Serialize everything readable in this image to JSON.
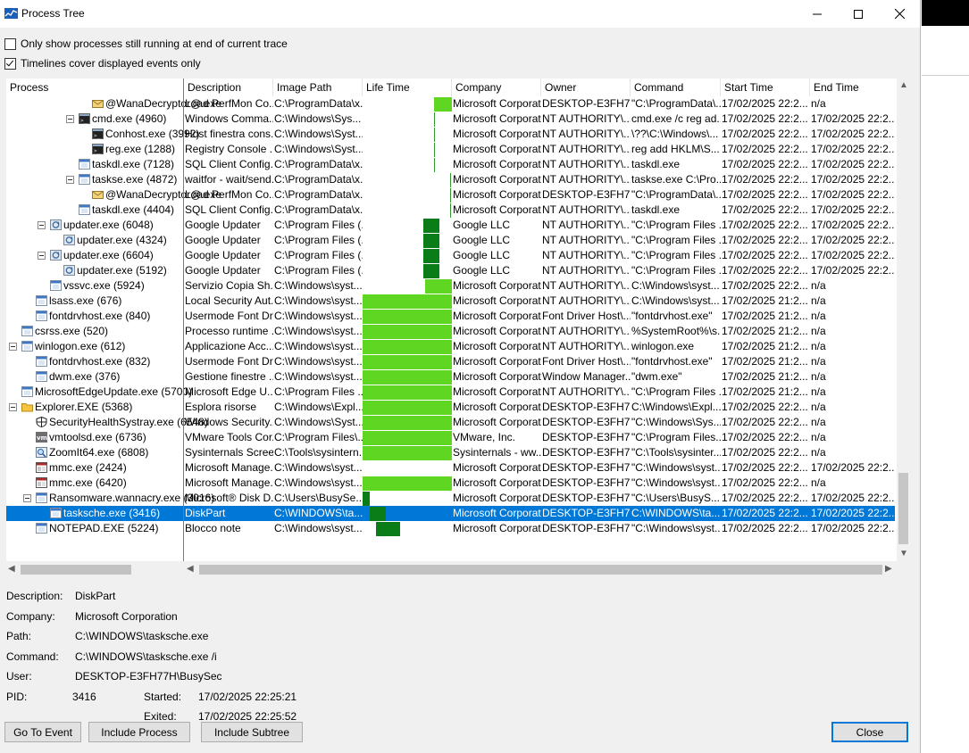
{
  "window": {
    "title": "Process Tree"
  },
  "options": [
    {
      "label": "Only show processes still running at end of current trace",
      "checked": false
    },
    {
      "label": "Timelines cover displayed events only",
      "checked": true
    }
  ],
  "columns": [
    "Process",
    "Description",
    "Image Path",
    "Life Time",
    "Company",
    "Owner",
    "Command",
    "Start Time",
    "End Time"
  ],
  "rows": [
    {
      "name": "@WanaDecryptor@.exe",
      "indent": 96,
      "expander": false,
      "icon": "envelope-icon",
      "desc": "Load PerfMon Co...",
      "path": "C:\\ProgramData\\x...",
      "company": "Microsoft Corporat...",
      "owner": "DESKTOP-E3FH7...",
      "cmd": "\"C:\\ProgramData\\...",
      "start": "17/02/2025 22:2...",
      "end": "n/a",
      "lt": {
        "type": "light",
        "start": 0.795,
        "end": 1.0
      }
    },
    {
      "name": "cmd.exe (4960)",
      "indent": 81,
      "expander": true,
      "icon": "console-icon",
      "desc": "Windows Comma...",
      "path": "C:\\Windows\\Sys...",
      "company": "Microsoft Corporat...",
      "owner": "NT AUTHORITY\\...",
      "cmd": "cmd.exe /c reg ad...",
      "start": "17/02/2025 22:2...",
      "end": "17/02/2025 22:2...",
      "lt": {
        "type": "thin",
        "start": 0.8
      }
    },
    {
      "name": "Conhost.exe (3992)",
      "indent": 96,
      "expander": false,
      "icon": "console-icon",
      "desc": "Host finestra cons...",
      "path": "C:\\Windows\\Syst...",
      "company": "Microsoft Corporat...",
      "owner": "NT AUTHORITY\\...",
      "cmd": "\\??\\C:\\Windows\\...",
      "start": "17/02/2025 22:2...",
      "end": "17/02/2025 22:2...",
      "lt": {
        "type": "thin",
        "start": 0.8
      }
    },
    {
      "name": "reg.exe (1288)",
      "indent": 96,
      "expander": false,
      "icon": "console-icon",
      "desc": "Registry Console ...",
      "path": "C:\\Windows\\Syst...",
      "company": "Microsoft Corporat...",
      "owner": "NT AUTHORITY\\...",
      "cmd": "reg  add HKLM\\S...",
      "start": "17/02/2025 22:2...",
      "end": "17/02/2025 22:2...",
      "lt": {
        "type": "thin",
        "start": 0.8
      }
    },
    {
      "name": "taskdl.exe (7128)",
      "indent": 81,
      "expander": false,
      "icon": "app-icon",
      "desc": "SQL Client Config...",
      "path": "C:\\ProgramData\\x...",
      "company": "Microsoft Corporat...",
      "owner": "NT AUTHORITY\\...",
      "cmd": "taskdl.exe",
      "start": "17/02/2025 22:2...",
      "end": "17/02/2025 22:2...",
      "lt": {
        "type": "thin",
        "start": 0.8
      }
    },
    {
      "name": "taskse.exe (4872)",
      "indent": 81,
      "expander": true,
      "icon": "app-icon",
      "desc": "waitfor - wait/send...",
      "path": "C:\\ProgramData\\x...",
      "company": "Microsoft Corporat...",
      "owner": "NT AUTHORITY\\...",
      "cmd": "taskse.exe C:\\Pro...",
      "start": "17/02/2025 22:2...",
      "end": "17/02/2025 22:2...",
      "lt": {
        "type": "thin",
        "start": 0.975
      }
    },
    {
      "name": "@WanaDecryptor@.exe",
      "indent": 96,
      "expander": false,
      "icon": "envelope-icon",
      "desc": "Load PerfMon Co...",
      "path": "C:\\ProgramData\\x...",
      "company": "Microsoft Corporat...",
      "owner": "DESKTOP-E3FH7...",
      "cmd": "\"C:\\ProgramData\\...",
      "start": "17/02/2025 22:2...",
      "end": "17/02/2025 22:2...",
      "lt": {
        "type": "thin",
        "start": 0.975
      }
    },
    {
      "name": "taskdl.exe (4404)",
      "indent": 81,
      "expander": false,
      "icon": "app-icon",
      "desc": "SQL Client Config...",
      "path": "C:\\ProgramData\\x...",
      "company": "Microsoft Corporat...",
      "owner": "NT AUTHORITY\\...",
      "cmd": "taskdl.exe",
      "start": "17/02/2025 22:2...",
      "end": "17/02/2025 22:2...",
      "lt": {
        "type": "thin",
        "start": 0.975
      }
    },
    {
      "name": "updater.exe (6048)",
      "indent": 49,
      "expander": true,
      "icon": "updater-icon",
      "desc": "Google Updater",
      "path": "C:\\Program Files (...",
      "company": "Google LLC",
      "owner": "NT AUTHORITY\\...",
      "cmd": "\"C:\\Program Files ...",
      "start": "17/02/2025 22:2...",
      "end": "17/02/2025 22:2...",
      "lt": {
        "type": "dark",
        "start": 0.68,
        "end": 0.86
      }
    },
    {
      "name": "updater.exe (4324)",
      "indent": 64,
      "expander": false,
      "icon": "updater-icon",
      "desc": "Google Updater",
      "path": "C:\\Program Files (...",
      "company": "Google LLC",
      "owner": "NT AUTHORITY\\...",
      "cmd": "\"C:\\Program Files ...",
      "start": "17/02/2025 22:2...",
      "end": "17/02/2025 22:2...",
      "lt": {
        "type": "dark",
        "start": 0.68,
        "end": 0.86
      }
    },
    {
      "name": "updater.exe (6604)",
      "indent": 49,
      "expander": true,
      "icon": "updater-icon",
      "desc": "Google Updater",
      "path": "C:\\Program Files (...",
      "company": "Google LLC",
      "owner": "NT AUTHORITY\\...",
      "cmd": "\"C:\\Program Files ...",
      "start": "17/02/2025 22:2...",
      "end": "17/02/2025 22:2...",
      "lt": {
        "type": "dark",
        "start": 0.68,
        "end": 0.86
      }
    },
    {
      "name": "updater.exe (5192)",
      "indent": 64,
      "expander": false,
      "icon": "updater-icon",
      "desc": "Google Updater",
      "path": "C:\\Program Files (...",
      "company": "Google LLC",
      "owner": "NT AUTHORITY\\...",
      "cmd": "\"C:\\Program Files ...",
      "start": "17/02/2025 22:2...",
      "end": "17/02/2025 22:2...",
      "lt": {
        "type": "dark",
        "start": 0.68,
        "end": 0.86
      }
    },
    {
      "name": "vssvc.exe (5924)",
      "indent": 49,
      "expander": false,
      "icon": "app-icon",
      "desc": "Servizio Copia Sh...",
      "path": "C:\\Windows\\syst...",
      "company": "Microsoft Corporat...",
      "owner": "NT AUTHORITY\\...",
      "cmd": "C:\\Windows\\syst...",
      "start": "17/02/2025 22:2...",
      "end": "n/a",
      "lt": {
        "type": "light",
        "start": 0.7,
        "end": 1.0
      }
    },
    {
      "name": "lsass.exe (676)",
      "indent": 33,
      "expander": false,
      "icon": "app-icon",
      "desc": "Local Security Aut...",
      "path": "C:\\Windows\\syst...",
      "company": "Microsoft Corporat...",
      "owner": "NT AUTHORITY\\...",
      "cmd": "C:\\Windows\\syst...",
      "start": "17/02/2025 21:2...",
      "end": "n/a",
      "lt": {
        "type": "light",
        "start": 0.0,
        "end": 1.0
      }
    },
    {
      "name": "fontdrvhost.exe (840)",
      "indent": 33,
      "expander": false,
      "icon": "app-icon",
      "desc": "Usermode Font Dr...",
      "path": "C:\\Windows\\syst...",
      "company": "Microsoft Corporat...",
      "owner": "Font Driver Host\\...",
      "cmd": "\"fontdrvhost.exe\"",
      "start": "17/02/2025 21:2...",
      "end": "n/a",
      "lt": {
        "type": "light",
        "start": 0.0,
        "end": 1.0
      }
    },
    {
      "name": "csrss.exe (520)",
      "indent": 17,
      "expander": false,
      "icon": "app-icon",
      "desc": "Processo runtime ...",
      "path": "C:\\Windows\\syst...",
      "company": "Microsoft Corporat...",
      "owner": "NT AUTHORITY\\...",
      "cmd": "%SystemRoot%\\s...",
      "start": "17/02/2025 21:2...",
      "end": "n/a",
      "lt": {
        "type": "light",
        "start": 0.0,
        "end": 1.0
      }
    },
    {
      "name": "winlogon.exe (612)",
      "indent": 17,
      "expander": true,
      "icon": "app-icon",
      "desc": "Applicazione Acc...",
      "path": "C:\\Windows\\syst...",
      "company": "Microsoft Corporat...",
      "owner": "NT AUTHORITY\\...",
      "cmd": "winlogon.exe",
      "start": "17/02/2025 21:2...",
      "end": "n/a",
      "lt": {
        "type": "light",
        "start": 0.0,
        "end": 1.0
      }
    },
    {
      "name": "fontdrvhost.exe (832)",
      "indent": 33,
      "expander": false,
      "icon": "app-icon",
      "desc": "Usermode Font Dr...",
      "path": "C:\\Windows\\syst...",
      "company": "Microsoft Corporat...",
      "owner": "Font Driver Host\\...",
      "cmd": "\"fontdrvhost.exe\"",
      "start": "17/02/2025 21:2...",
      "end": "n/a",
      "lt": {
        "type": "light",
        "start": 0.0,
        "end": 1.0
      }
    },
    {
      "name": "dwm.exe (376)",
      "indent": 33,
      "expander": false,
      "icon": "app-icon",
      "desc": "Gestione finestre ...",
      "path": "C:\\Windows\\syst...",
      "company": "Microsoft Corporat...",
      "owner": "Window Manager...",
      "cmd": "\"dwm.exe\"",
      "start": "17/02/2025 21:2...",
      "end": "n/a",
      "lt": {
        "type": "light",
        "start": 0.0,
        "end": 1.0
      }
    },
    {
      "name": "MicrosoftEdgeUpdate.exe (5700)",
      "indent": 17,
      "expander": false,
      "icon": "app-icon",
      "desc": "Microsoft Edge U...",
      "path": "C:\\Program Files ...",
      "company": "Microsoft Corporat...",
      "owner": "NT AUTHORITY\\...",
      "cmd": "\"C:\\Program Files ...",
      "start": "17/02/2025 21:2...",
      "end": "n/a",
      "lt": {
        "type": "light",
        "start": 0.0,
        "end": 1.0
      }
    },
    {
      "name": "Explorer.EXE (5368)",
      "indent": 17,
      "expander": true,
      "icon": "folder-icon",
      "desc": "Esplora risorse",
      "path": "C:\\Windows\\Expl...",
      "company": "Microsoft Corporat...",
      "owner": "DESKTOP-E3FH7...",
      "cmd": "C:\\Windows\\Expl...",
      "start": "17/02/2025 22:2...",
      "end": "n/a",
      "lt": {
        "type": "light",
        "start": 0.0,
        "end": 1.0
      }
    },
    {
      "name": "SecurityHealthSystray.exe (6548)",
      "indent": 33,
      "expander": false,
      "icon": "shield-icon",
      "desc": "Windows Security...",
      "path": "C:\\Windows\\Syst...",
      "company": "Microsoft Corporat...",
      "owner": "DESKTOP-E3FH7...",
      "cmd": "\"C:\\Windows\\Sys...",
      "start": "17/02/2025 22:2...",
      "end": "n/a",
      "lt": {
        "type": "light",
        "start": 0.0,
        "end": 1.0
      }
    },
    {
      "name": "vmtoolsd.exe (6736)",
      "indent": 33,
      "expander": false,
      "icon": "vm-icon",
      "desc": "VMware Tools Cor...",
      "path": "C:\\Program Files\\...",
      "company": "VMware, Inc.",
      "owner": "DESKTOP-E3FH7...",
      "cmd": "\"C:\\Program Files...",
      "start": "17/02/2025 22:2...",
      "end": "n/a",
      "lt": {
        "type": "light",
        "start": 0.0,
        "end": 1.0
      }
    },
    {
      "name": "ZoomIt64.exe (6808)",
      "indent": 33,
      "expander": false,
      "icon": "zoom-icon",
      "desc": "Sysinternals Scree...",
      "path": "C:\\Tools\\sysintern...",
      "company": "Sysinternals - ww...",
      "owner": "DESKTOP-E3FH7...",
      "cmd": "\"C:\\Tools\\sysinter...",
      "start": "17/02/2025 22:2...",
      "end": "n/a",
      "lt": {
        "type": "light",
        "start": 0.0,
        "end": 1.0
      }
    },
    {
      "name": "mmc.exe (2424)",
      "indent": 33,
      "expander": false,
      "icon": "mmc-icon",
      "desc": "Microsoft Manage...",
      "path": "C:\\Windows\\syst...",
      "company": "Microsoft Corporat...",
      "owner": "DESKTOP-E3FH7...",
      "cmd": "\"C:\\Windows\\syst...",
      "start": "17/02/2025 22:2...",
      "end": "17/02/2025 22:2...",
      "lt": {
        "type": "none"
      }
    },
    {
      "name": "mmc.exe (6420)",
      "indent": 33,
      "expander": false,
      "icon": "mmc-icon",
      "desc": "Microsoft Manage...",
      "path": "C:\\Windows\\syst...",
      "company": "Microsoft Corporat...",
      "owner": "DESKTOP-E3FH7...",
      "cmd": "\"C:\\Windows\\syst...",
      "start": "17/02/2025 22:2...",
      "end": "n/a",
      "lt": {
        "type": "light",
        "start": 0.0,
        "end": 1.0
      }
    },
    {
      "name": "Ransomware.wannacry.exe (3016)",
      "indent": 33,
      "expander": true,
      "icon": "app-icon",
      "desc": "Microsoft® Disk D...",
      "path": "C:\\Users\\BusySe...",
      "company": "Microsoft Corporat...",
      "owner": "DESKTOP-E3FH7...",
      "cmd": "\"C:\\Users\\BusyS...",
      "start": "17/02/2025 22:2...",
      "end": "17/02/2025 22:2...",
      "lt": {
        "type": "dark",
        "start": 0.0,
        "end": 0.08
      }
    },
    {
      "name": "tasksche.exe (3416)",
      "indent": 49,
      "expander": false,
      "icon": "app-icon",
      "desc": "DiskPart",
      "path": "C:\\WINDOWS\\ta...",
      "company": "Microsoft Corporat...",
      "owner": "DESKTOP-E3FH7...",
      "cmd": "C:\\WINDOWS\\ta...",
      "start": "17/02/2025 22:2...",
      "end": "17/02/2025 22:2...",
      "selected": true,
      "lt": {
        "type": "dark",
        "start": 0.08,
        "end": 0.26
      }
    },
    {
      "name": "NOTEPAD.EXE (5224)",
      "indent": 33,
      "expander": false,
      "icon": "app-icon",
      "desc": "Blocco note",
      "path": "C:\\Windows\\syst...",
      "company": "Microsoft Corporat...",
      "owner": "DESKTOP-E3FH7...",
      "cmd": "\"C:\\Windows\\syst...",
      "start": "17/02/2025 22:2...",
      "end": "17/02/2025 22:2...",
      "lt": {
        "type": "dark",
        "start": 0.15,
        "end": 0.42
      }
    }
  ],
  "details": {
    "description_label": "Description:",
    "description": "DiskPart",
    "company_label": "Company:",
    "company": "Microsoft Corporation",
    "path_label": "Path:",
    "path": "C:\\WINDOWS\\tasksche.exe",
    "command_label": "Command:",
    "command": "C:\\WINDOWS\\tasksche.exe /i",
    "user_label": "User:",
    "user": "DESKTOP-E3FH77H\\BusySec",
    "pid_label": "PID:",
    "pid": "3416",
    "started_label": "Started:",
    "started": "17/02/2025 22:25:21",
    "exited_label": "Exited:",
    "exited": "17/02/2025 22:25:52"
  },
  "buttons": {
    "go_to_event": "Go To Event",
    "include_process": "Include Process",
    "include_subtree": "Include Subtree",
    "close": "Close"
  },
  "colors": {
    "selection": "#0078d7",
    "bar_light": "#5fd622",
    "bar_dark": "#0a7d18"
  }
}
